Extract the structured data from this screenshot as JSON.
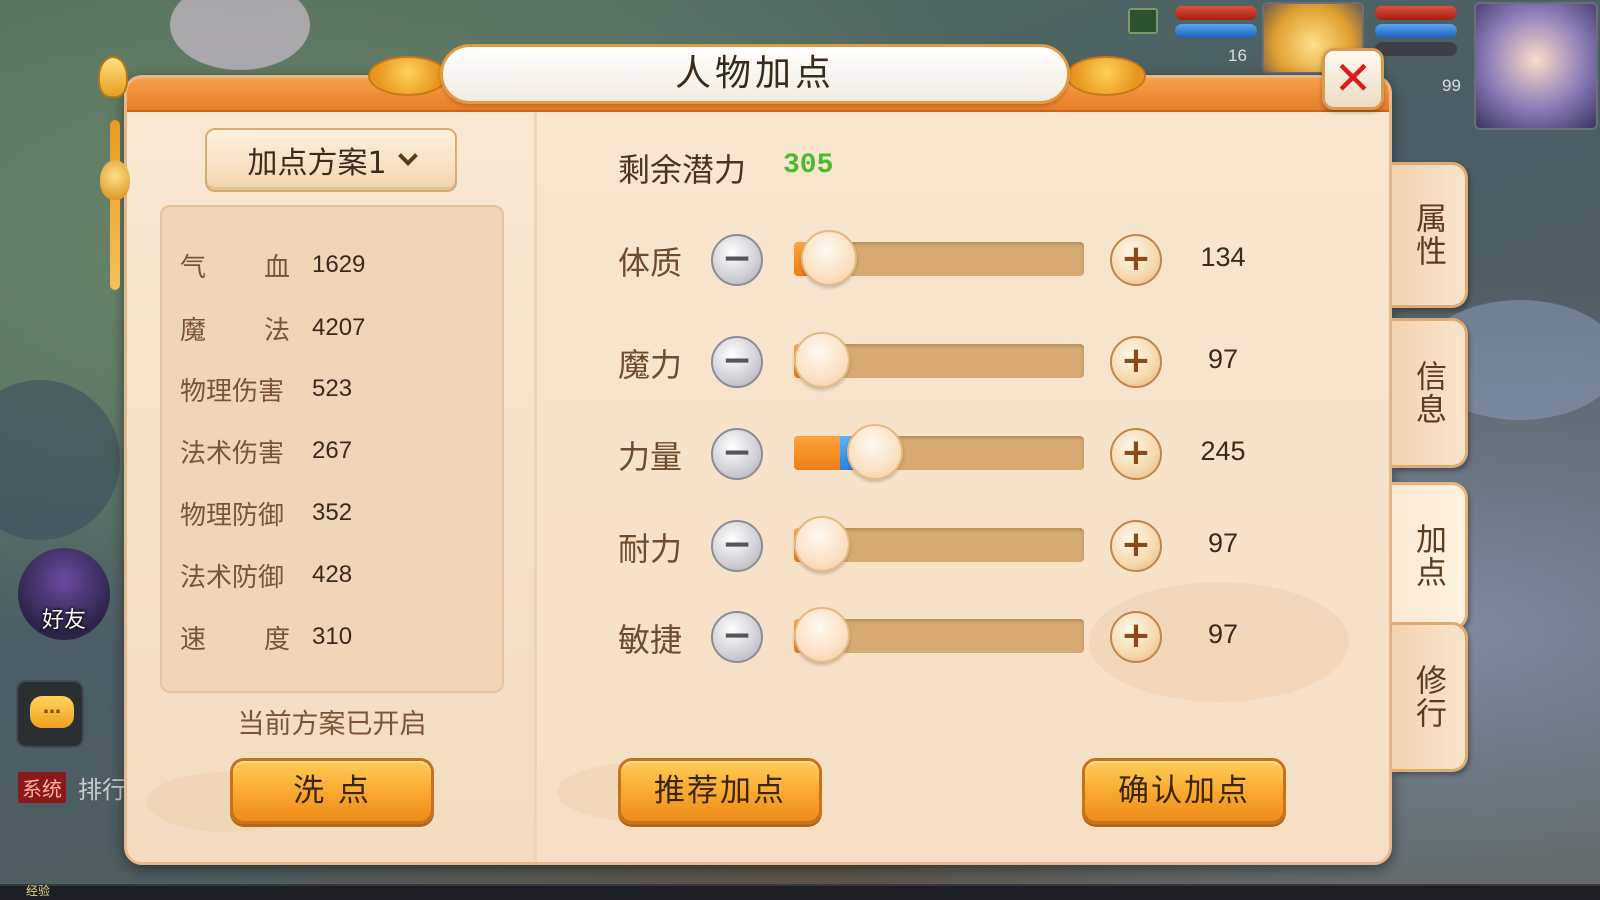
{
  "window": {
    "title": "人物加点"
  },
  "scheme": {
    "selected": "加点方案1",
    "status_text": "当前方案已开启",
    "reset_button": "洗 点"
  },
  "stats": [
    {
      "name": [
        "气",
        "血"
      ],
      "value": "1629"
    },
    {
      "name": [
        "魔",
        "法"
      ],
      "value": "4207"
    },
    {
      "name": [
        "物理伤害"
      ],
      "value": "523"
    },
    {
      "name": [
        "法术伤害"
      ],
      "value": "267"
    },
    {
      "name": [
        "物理防御"
      ],
      "value": "352"
    },
    {
      "name": [
        "法术防御"
      ],
      "value": "428"
    },
    {
      "name": [
        "速",
        "度"
      ],
      "value": "310"
    }
  ],
  "potential": {
    "label": "剩余潜力",
    "value": "305"
  },
  "attributes": [
    {
      "name": "体质",
      "value": "134",
      "base_fraction": 0.12,
      "added_fraction": 0.0
    },
    {
      "name": "魔力",
      "value": "97",
      "base_fraction": 0.03,
      "added_fraction": 0.0
    },
    {
      "name": "力量",
      "value": "245",
      "base_fraction": 0.16,
      "added_fraction": 0.12
    },
    {
      "name": "耐力",
      "value": "97",
      "base_fraction": 0.03,
      "added_fraction": 0.0
    },
    {
      "name": "敏捷",
      "value": "97",
      "base_fraction": 0.03,
      "added_fraction": 0.0
    }
  ],
  "buttons": {
    "recommend": "推荐加点",
    "confirm": "确认加点"
  },
  "side_tabs": [
    {
      "label": "属性",
      "active": false
    },
    {
      "label": "信息",
      "active": false
    },
    {
      "label": "加点",
      "active": true
    },
    {
      "label": "修行",
      "active": false
    }
  ],
  "hud": {
    "pet_level": "16",
    "player_level": "99",
    "friend_label": "好友",
    "chat_icon": "…",
    "system_tag": "系统",
    "system_text": "排行",
    "exp_label": "经验"
  },
  "colors": {
    "potential_value": "#4cba2e",
    "close_x": "#e0191a",
    "fill_base": "#f08a1e",
    "fill_added": "#3a90e8"
  },
  "icons": {
    "close": "close-icon",
    "minus": "minus-icon",
    "plus": "plus-icon",
    "dropdown": "chevron-down-icon",
    "chat": "chat-bubble-icon"
  }
}
